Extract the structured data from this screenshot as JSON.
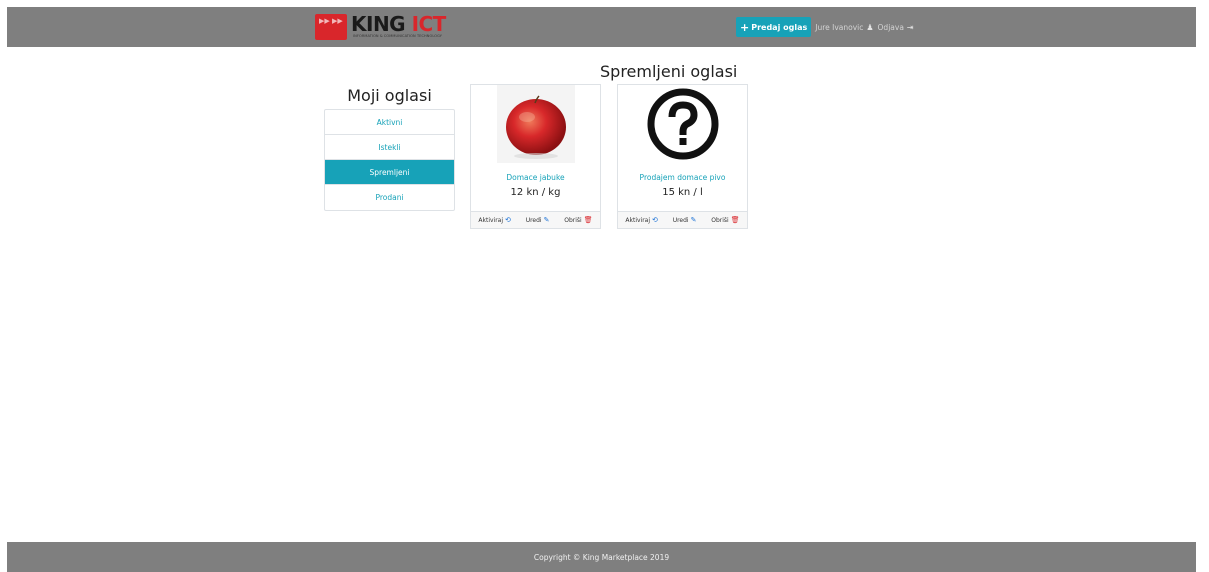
{
  "header": {
    "logo_word_part1": "KING",
    "logo_word_part2": "ICT",
    "logo_tagline": "INFORMATION & COMMUNICATION TECHNOLOGY",
    "post_ad_label": "Predaj oglas",
    "user_name": "Jure Ivanovic",
    "logout_label": "Odjava",
    "accent_color": "#17a2b8",
    "bar_color": "#7f7f7f",
    "icons": [
      "plus-icon",
      "user-icon",
      "sign-out-icon"
    ]
  },
  "sidebar": {
    "title": "Moji oglasi",
    "items": [
      {
        "label": "Aktivni",
        "active": false
      },
      {
        "label": "Istekli",
        "active": false
      },
      {
        "label": "Spremljeni",
        "active": true
      },
      {
        "label": "Prodani",
        "active": false
      }
    ]
  },
  "main": {
    "title": "Spremljeni oglasi",
    "cards": [
      {
        "title": "Domace jabuke",
        "price": "12 kn / kg",
        "image_icon": "apple-photo",
        "actions": {
          "activate": "Aktiviraj",
          "edit": "Uredi",
          "delete": "Obriši"
        }
      },
      {
        "title": "Prodajem domace pivo",
        "price": "15 kn / l",
        "image_icon": "question-mark-icon",
        "actions": {
          "activate": "Aktiviraj",
          "edit": "Uredi",
          "delete": "Obriši"
        }
      }
    ]
  },
  "footer": {
    "copyright": "Copyright © King Marketplace 2019"
  }
}
